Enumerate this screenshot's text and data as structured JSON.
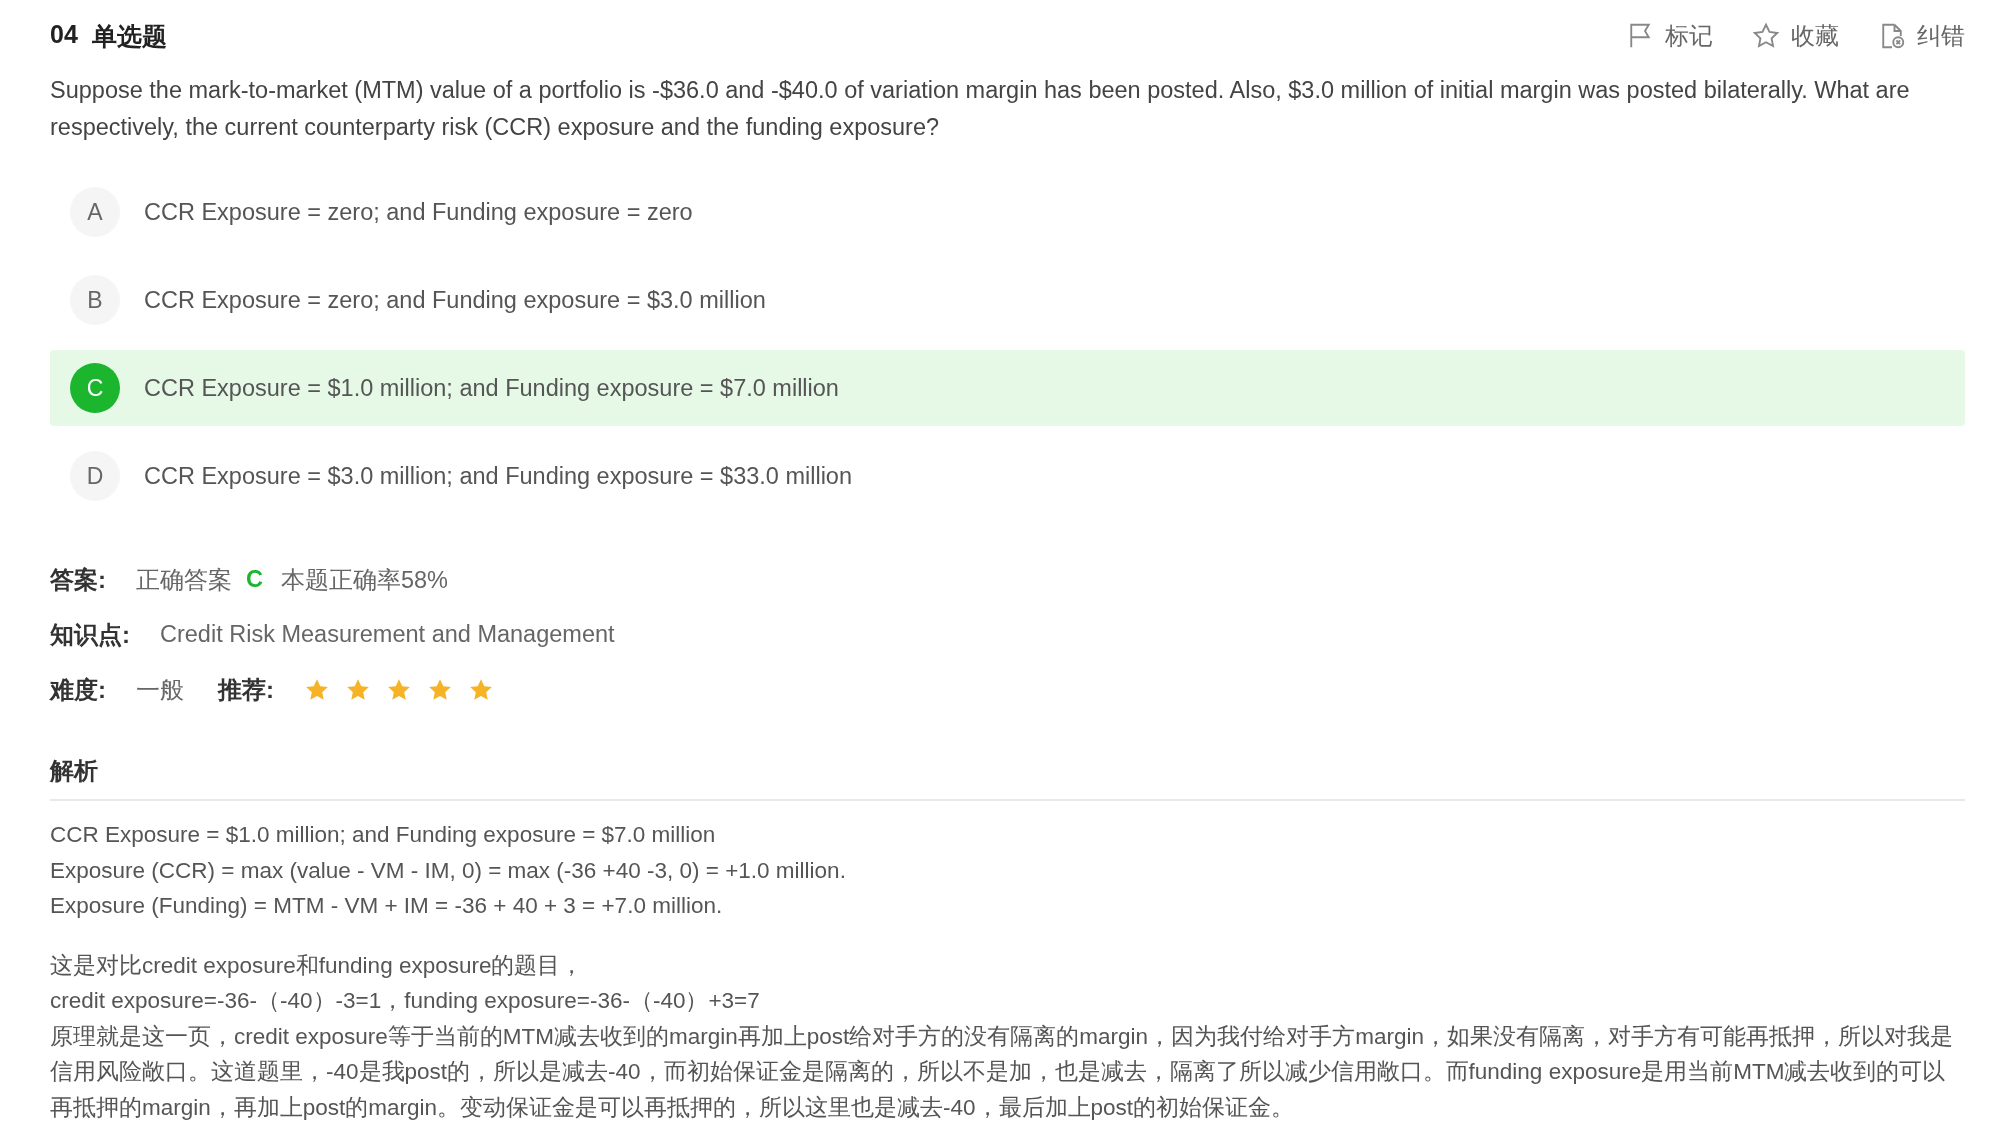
{
  "header": {
    "number": "04",
    "type": "单选题",
    "actions": [
      {
        "kind": "flag",
        "label": "标记"
      },
      {
        "kind": "star",
        "label": "收藏"
      },
      {
        "kind": "report",
        "label": "纠错"
      }
    ]
  },
  "question": "Suppose the mark-to-market (MTM) value of a portfolio is -$36.0 and -$40.0 of variation margin has been posted. Also, $3.0 million of initial margin was posted bilaterally. What are respectively, the current counterparty risk (CCR) exposure and the funding exposure?",
  "options": [
    {
      "letter": "A",
      "text": "CCR Exposure = zero; and Funding exposure = zero",
      "selected": false
    },
    {
      "letter": "B",
      "text": "CCR Exposure = zero; and Funding exposure = $3.0 million",
      "selected": false
    },
    {
      "letter": "C",
      "text": "CCR Exposure = $1.0 million; and Funding exposure = $7.0 million",
      "selected": true
    },
    {
      "letter": "D",
      "text": "CCR Exposure = $3.0 million; and Funding exposure = $33.0 million",
      "selected": false
    }
  ],
  "answer": {
    "label": "答案:",
    "prefix": "正确答案",
    "letter": "C",
    "rate": "本题正确率58%"
  },
  "knowledge": {
    "label": "知识点:",
    "value": "Credit Risk Measurement and Management"
  },
  "difficulty": {
    "label": "难度:",
    "value": "一般",
    "recommend_label": "推荐:",
    "stars": 5
  },
  "analysis": {
    "title": "解析",
    "lines": [
      "CCR Exposure = $1.0 million; and Funding exposure = $7.0 million",
      "Exposure (CCR) = max (value - VM - IM, 0) = max (-36 +40 -3, 0) = +1.0 million.",
      "Exposure (Funding) = MTM - VM + IM = -36 + 40 + 3 = +7.0 million."
    ],
    "notes": [
      "这是对比credit exposure和funding exposure的题目，",
      "credit exposure=-36-（-40）-3=1，funding exposure=-36-（-40）+3=7",
      "原理就是这一页，credit exposure等于当前的MTM减去收到的margin再加上post给对手方的没有隔离的margin，因为我付给对手方margin，如果没有隔离，对手方有可能再抵押，所以对我是信用风险敞口。这道题里，-40是我post的，所以是减去-40，而初始保证金是隔离的，所以不是加，也是减去，隔离了所以减少信用敞口。而funding exposure是用当前MTM减去收到的可以再抵押的margin，再加上post的margin。变动保证金是可以再抵押的，所以这里也是减去-40，最后加上post的初始保证金。"
    ]
  }
}
